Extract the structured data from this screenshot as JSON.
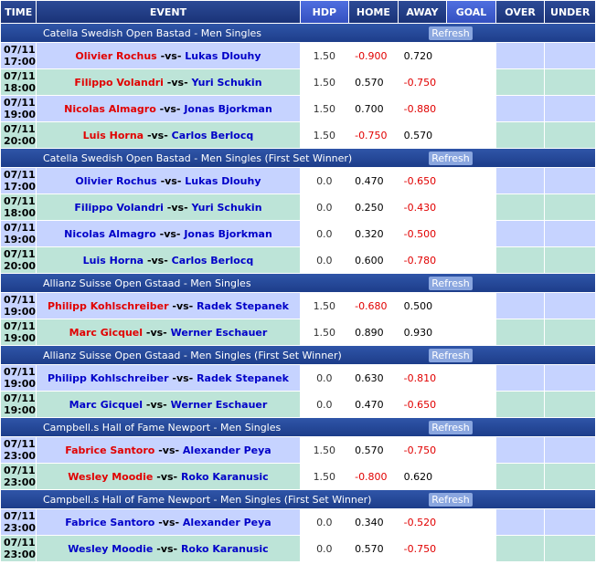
{
  "header": {
    "time": "TIME",
    "event": "EVENT",
    "hdp": "HDP",
    "home": "HOME",
    "away": "AWAY",
    "goal": "GOAL",
    "over": "OVER",
    "under": "UNDER"
  },
  "refresh_label": "Refresh",
  "sections": [
    {
      "title": "Catella Swedish Open Bastad - Men Singles",
      "rows": [
        {
          "date": "07/11",
          "time": "17:00",
          "home": "Olivier Rochus",
          "away": "Lukas Dlouhy",
          "fav": "home",
          "hdp": "1.50",
          "home_odds": "-0.900",
          "away_odds": "0.720"
        },
        {
          "date": "07/11",
          "time": "18:00",
          "home": "Filippo Volandri",
          "away": "Yuri Schukin",
          "fav": "home",
          "hdp": "1.50",
          "home_odds": "0.570",
          "away_odds": "-0.750"
        },
        {
          "date": "07/11",
          "time": "19:00",
          "home": "Nicolas Almagro",
          "away": "Jonas Bjorkman",
          "fav": "home",
          "hdp": "1.50",
          "home_odds": "0.700",
          "away_odds": "-0.880"
        },
        {
          "date": "07/11",
          "time": "20:00",
          "home": "Luis Horna",
          "away": "Carlos Berlocq",
          "fav": "home",
          "hdp": "1.50",
          "home_odds": "-0.750",
          "away_odds": "0.570"
        }
      ]
    },
    {
      "title": "Catella Swedish Open Bastad - Men Singles (First Set Winner)",
      "rows": [
        {
          "date": "07/11",
          "time": "17:00",
          "home": "Olivier Rochus",
          "away": "Lukas Dlouhy",
          "fav": "none",
          "hdp": "0.0",
          "home_odds": "0.470",
          "away_odds": "-0.650"
        },
        {
          "date": "07/11",
          "time": "18:00",
          "home": "Filippo Volandri",
          "away": "Yuri Schukin",
          "fav": "none",
          "hdp": "0.0",
          "home_odds": "0.250",
          "away_odds": "-0.430"
        },
        {
          "date": "07/11",
          "time": "19:00",
          "home": "Nicolas Almagro",
          "away": "Jonas Bjorkman",
          "fav": "none",
          "hdp": "0.0",
          "home_odds": "0.320",
          "away_odds": "-0.500"
        },
        {
          "date": "07/11",
          "time": "20:00",
          "home": "Luis Horna",
          "away": "Carlos Berlocq",
          "fav": "none",
          "hdp": "0.0",
          "home_odds": "0.600",
          "away_odds": "-0.780"
        }
      ]
    },
    {
      "title": "Allianz Suisse Open Gstaad - Men Singles",
      "rows": [
        {
          "date": "07/11",
          "time": "19:00",
          "home": "Philipp Kohlschreiber",
          "away": "Radek Stepanek",
          "fav": "home",
          "hdp": "1.50",
          "home_odds": "-0.680",
          "away_odds": "0.500"
        },
        {
          "date": "07/11",
          "time": "19:00",
          "home": "Marc Gicquel",
          "away": "Werner Eschauer",
          "fav": "home",
          "hdp": "1.50",
          "home_odds": "0.890",
          "away_odds": "0.930"
        }
      ]
    },
    {
      "title": "Allianz Suisse Open Gstaad - Men Singles (First Set Winner)",
      "rows": [
        {
          "date": "07/11",
          "time": "19:00",
          "home": "Philipp Kohlschreiber",
          "away": "Radek Stepanek",
          "fav": "none",
          "hdp": "0.0",
          "home_odds": "0.630",
          "away_odds": "-0.810"
        },
        {
          "date": "07/11",
          "time": "19:00",
          "home": "Marc Gicquel",
          "away": "Werner Eschauer",
          "fav": "none",
          "hdp": "0.0",
          "home_odds": "0.470",
          "away_odds": "-0.650"
        }
      ]
    },
    {
      "title": "Campbell.s Hall of Fame Newport - Men Singles",
      "rows": [
        {
          "date": "07/11",
          "time": "23:00",
          "home": "Fabrice Santoro",
          "away": "Alexander Peya",
          "fav": "home",
          "hdp": "1.50",
          "home_odds": "0.570",
          "away_odds": "-0.750"
        },
        {
          "date": "07/11",
          "time": "23:00",
          "home": "Wesley Moodie",
          "away": "Roko Karanusic",
          "fav": "home",
          "hdp": "1.50",
          "home_odds": "-0.800",
          "away_odds": "0.620"
        }
      ]
    },
    {
      "title": "Campbell.s Hall of Fame Newport - Men Singles (First Set Winner)",
      "rows": [
        {
          "date": "07/11",
          "time": "23:00",
          "home": "Fabrice Santoro",
          "away": "Alexander Peya",
          "fav": "none",
          "hdp": "0.0",
          "home_odds": "0.340",
          "away_odds": "-0.520"
        },
        {
          "date": "07/11",
          "time": "23:00",
          "home": "Wesley Moodie",
          "away": "Roko Karanusic",
          "fav": "none",
          "hdp": "0.0",
          "home_odds": "0.570",
          "away_odds": "-0.750"
        }
      ]
    }
  ],
  "vs_text": "-vs-",
  "colors": {
    "favorite": "#e10000",
    "underdog": "#0000c8",
    "negative_odds": "#e10000",
    "header": "#1d3d8a",
    "row_blue": "#c6d3ff",
    "row_green": "#bde4d8"
  }
}
